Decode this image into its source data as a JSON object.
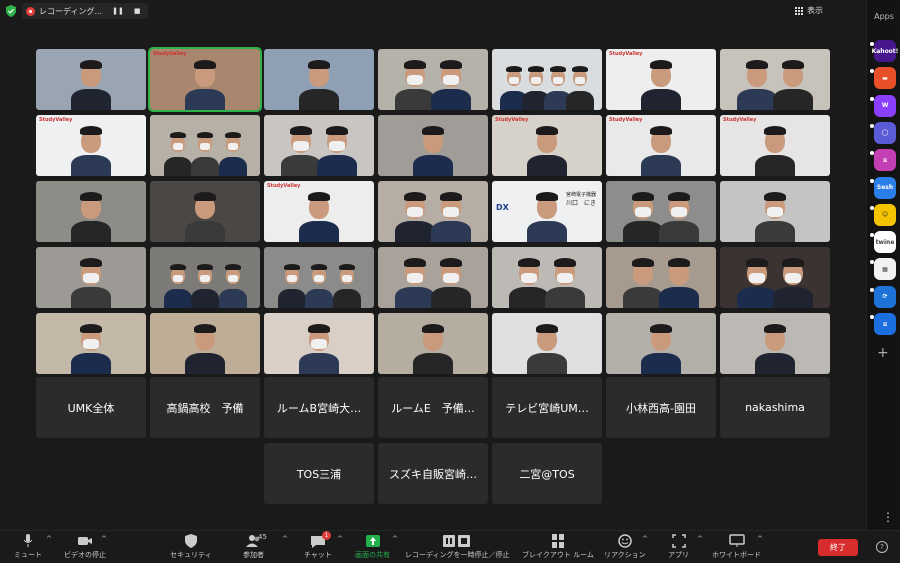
{
  "topbar": {
    "recording_label": "レコーディング...",
    "pause_symbol": "❚❚",
    "stop_symbol": "■",
    "view_label": "表示"
  },
  "apps_rail": {
    "title": "Apps",
    "apps": [
      {
        "name": "Kahoot!",
        "text": "Kahoot!",
        "color": "#46178f"
      },
      {
        "name": "app-orange",
        "text": "▬",
        "color": "#e8502a"
      },
      {
        "name": "app-w",
        "text": "W",
        "color": "#8a3ffc"
      },
      {
        "name": "app-ring",
        "text": "◯",
        "color": "#5b5bd6"
      },
      {
        "name": "app-waves",
        "text": "≋",
        "color": "#c43fb3"
      },
      {
        "name": "Sesh",
        "text": "Sesh",
        "color": "#2b7de9"
      },
      {
        "name": "app-smile",
        "text": "☺",
        "color": "#f5c400"
      },
      {
        "name": "twine",
        "text": "twine",
        "color": "#ffffff"
      },
      {
        "name": "app-blocks",
        "text": "▦",
        "color": "#f2f2f2"
      },
      {
        "name": "app-sync",
        "text": "⟳",
        "color": "#1e73d8"
      },
      {
        "name": "app-stack",
        "text": "≡",
        "color": "#1d6fe0"
      }
    ]
  },
  "name_tiles": {
    "row1": [
      "UMK全体",
      "高鍋高校　予備",
      "ルームB宮崎大…",
      "ルームE　予備…",
      "テレビ宮崎UM…",
      "小林西高-園田",
      "nakashima"
    ],
    "row2": [
      "TOS三浦",
      "スズキ自販宮崎…",
      "二宮@TOS"
    ]
  },
  "tile_text": {
    "study_valley": "StudyValley",
    "dx": "DX",
    "sponsor_line": "宮崎電子機器",
    "sponsor_name": "川口　にき"
  },
  "toolbar": {
    "mute": "ミュート",
    "video_stop": "ビデオの停止",
    "security": "セキュリティ",
    "participants": "参加者",
    "participants_count": "45",
    "chat": "チャット",
    "chat_badge": "1",
    "share": "画面の共有",
    "recording_pause": "レコーディングを一時停止／停止",
    "breakout": "ブレイクアウト ルーム",
    "reactions": "リアクション",
    "apps": "アプリ",
    "whiteboard": "ホワイトボード",
    "end": "終了",
    "help": "?"
  },
  "colors": {
    "active_speaker": "#2eb24a",
    "share_green": "#23b14d",
    "end_red": "#d92c2c"
  }
}
